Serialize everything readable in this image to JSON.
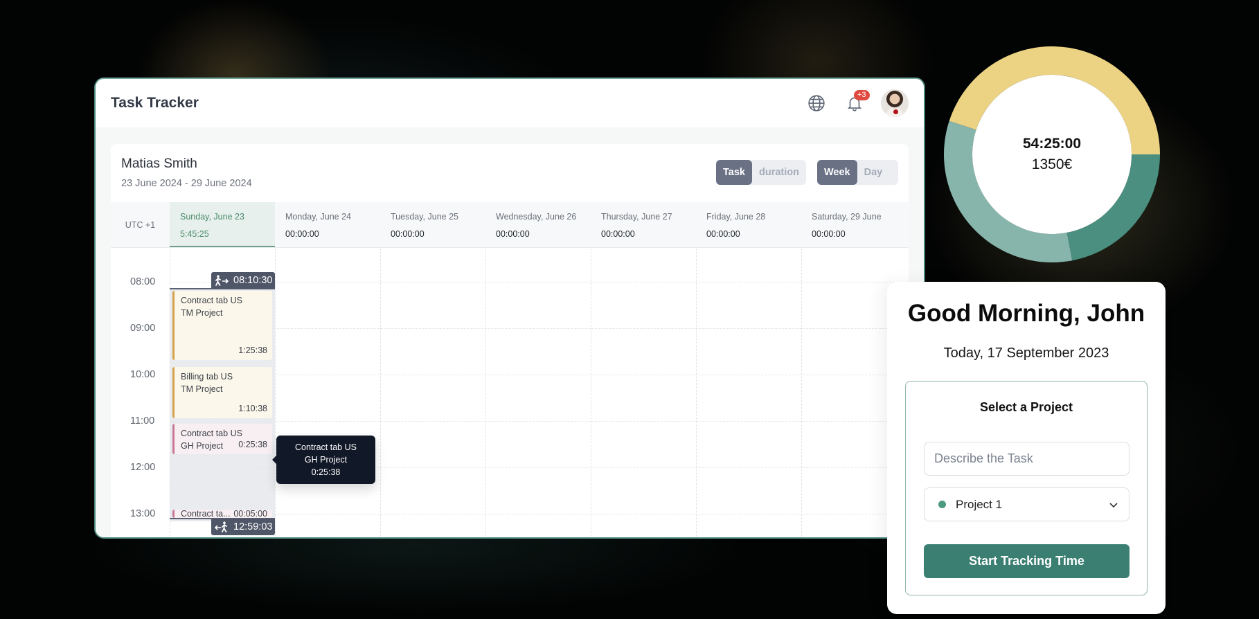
{
  "app": {
    "title": "Task Tracker",
    "notification_count": "+3",
    "icons": {
      "globe": "globe-icon",
      "bell": "bell-icon",
      "avatar": "user-avatar"
    }
  },
  "calendar": {
    "user_name": "Matias Smith",
    "date_range": "23 June 2024 - 29 June 2024",
    "toggle_mode": [
      {
        "label": "Task",
        "active": true
      },
      {
        "label": "duration",
        "active": false
      }
    ],
    "toggle_view": [
      {
        "label": "Week",
        "active": true
      },
      {
        "label": "Day",
        "active": false
      }
    ],
    "timezone": "UTC +1",
    "days": [
      {
        "name": "Sunday, June 23",
        "total": "5:45:25",
        "current": true
      },
      {
        "name": "Monday, June 24",
        "total": "00:00:00"
      },
      {
        "name": "Tuesday, June 25",
        "total": "00:00:00"
      },
      {
        "name": "Wednesday, June 26",
        "total": "00:00:00"
      },
      {
        "name": "Thursday, June 27",
        "total": "00:00:00"
      },
      {
        "name": "Friday, June 28",
        "total": "00:00:00"
      },
      {
        "name": "Saturday, 29 June",
        "total": "00:00:00"
      }
    ],
    "hours": [
      "08:00",
      "09:00",
      "10:00",
      "11:00",
      "12:00",
      "13:00"
    ],
    "check_in": {
      "icon": "walk-in-icon",
      "time": "08:10:30"
    },
    "check_out": {
      "icon": "walk-out-icon",
      "time": "12:59:03"
    },
    "events": [
      {
        "task": "Contract tab US",
        "project": "TM Project",
        "duration": "1:25:38",
        "color": "#d3a24b"
      },
      {
        "task": "Billing tab US",
        "project": "TM Project",
        "duration": "1:10:38",
        "color": "#d3a24b"
      },
      {
        "task": "Contract tab US",
        "project": "GH Project",
        "duration": "0:25:38",
        "color": "#c87895"
      },
      {
        "task": "Contract ta...",
        "project": "",
        "duration": "00:05:00",
        "color": "#c87895"
      }
    ],
    "tooltip": {
      "task": "Contract tab US",
      "project": "GH Project",
      "duration": "0:25:38"
    }
  },
  "summary": {
    "total_time": "54:25:00",
    "total_amount": "1350€"
  },
  "chart_data": {
    "type": "pie",
    "title": "",
    "center_labels": [
      "54:25:00",
      "1350€"
    ],
    "categories": [
      "Segment A (yellow)",
      "Segment B (dark teal)",
      "Segment C (light teal)"
    ],
    "values": [
      45,
      22,
      33
    ],
    "colors": [
      "#ecd383",
      "#4a8f7f",
      "#87b5ac"
    ],
    "donut": true
  },
  "greeting": {
    "title": "Good Morning, John",
    "date": "Today, 17 September 2023",
    "project_heading": "Select a Project",
    "task_placeholder": "Describe the Task",
    "task_value": "",
    "selected_project": "Project 1",
    "selected_project_color": "#4c9a80",
    "start_button": "Start Tracking Time"
  }
}
